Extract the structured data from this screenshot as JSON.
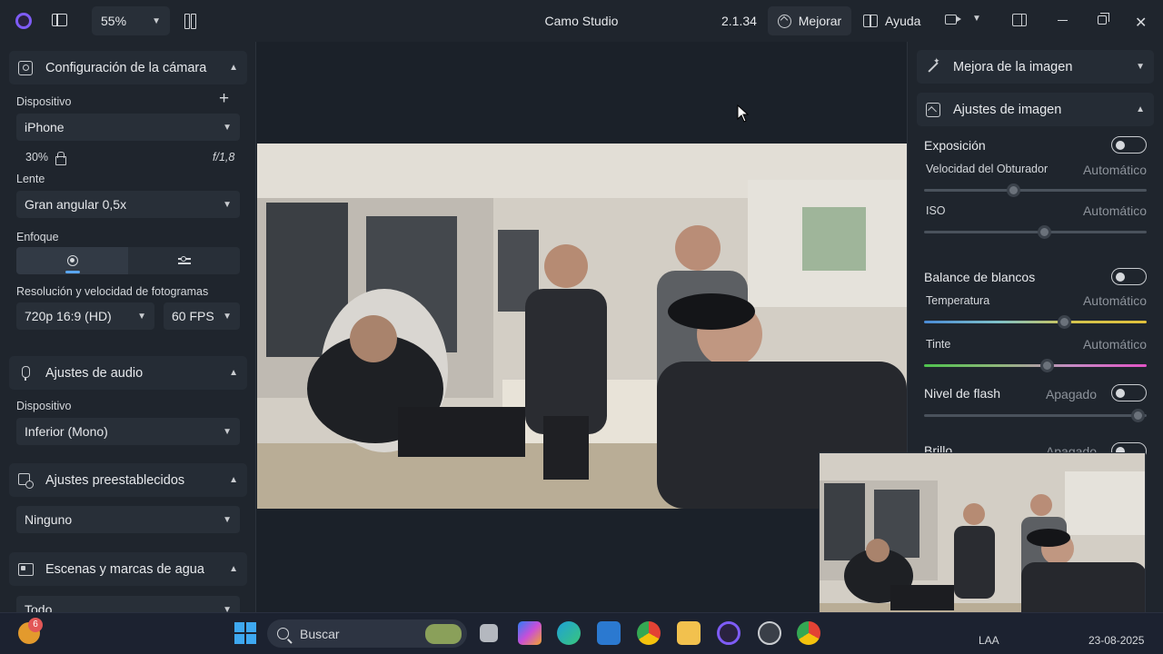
{
  "titlebar": {
    "zoom": "55%",
    "title": "Camo Studio",
    "version": "2.1.34",
    "enhance_label": "Mejorar",
    "help_label": "Ayuda"
  },
  "camera_settings": {
    "header": "Configuración de la cámara",
    "device_label": "Dispositivo",
    "device_value": "iPhone",
    "zoom_value": "30%",
    "aperture": "f/1,8",
    "lens_label": "Lente",
    "lens_value": "Gran angular 0,5x",
    "focus_label": "Enfoque",
    "resolution_label": "Resolución y velocidad de fotogramas",
    "resolution_value": "720p 16:9 (HD)",
    "fps_value": "60 FPS"
  },
  "audio_settings": {
    "header": "Ajustes de audio",
    "device_label": "Dispositivo",
    "device_value": "Inferior (Mono)"
  },
  "presets": {
    "header": "Ajustes preestablecidos",
    "value": "Ninguno"
  },
  "scenes": {
    "header": "Escenas y marcas de agua",
    "value": "Todo"
  },
  "image_enhancement": {
    "header": "Mejora de la imagen"
  },
  "image_settings": {
    "header": "Ajustes de imagen",
    "exposure_label": "Exposición",
    "shutter_label": "Velocidad del Obturador",
    "shutter_value": "Automático",
    "shutter_level": 0.4,
    "iso_label": "ISO",
    "iso_value": "Automático",
    "iso_level": 0.54,
    "wb_label": "Balance de blancos",
    "temp_label": "Temperatura",
    "temp_value": "Automático",
    "temp_level": 0.63,
    "tint_label": "Tinte",
    "tint_value": "Automático",
    "tint_level": 0.55,
    "flash_label": "Nivel de flash",
    "flash_value": "Apagado",
    "flash_level": 0.96,
    "brightness_label": "Brillo",
    "brightness_value": "Apagado"
  },
  "taskbar": {
    "notification_count": "6",
    "search_placeholder": "Buscar",
    "language": "LAA",
    "date": "23-08-2025"
  }
}
